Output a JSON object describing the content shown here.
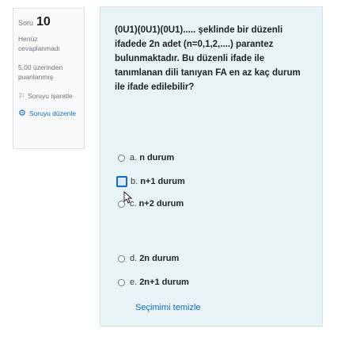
{
  "info": {
    "question_label": "Soru",
    "question_number": "10",
    "state": "Henüz cevaplanmadı",
    "grade": "5,00 üzerinden puanlanmış",
    "flag_label": "Soruyu işaretle",
    "edit_label": "Soruyu düzenle"
  },
  "question": {
    "text": "(0U1)(0U1)(0U1)..... şeklinde bir düzenli ifadede 2n adet (n=0,1,2,....) parantez bulunmaktadır. Bu düzenli ifade ile tanımlanan dili tanıyan FA en az kaç durum ile ifade edilebilir?"
  },
  "options": [
    {
      "letter": "a.",
      "text": "n durum"
    },
    {
      "letter": "b.",
      "text": "n+1 durum"
    },
    {
      "letter": "c.",
      "text": "n+2 durum"
    },
    {
      "letter": "d.",
      "text": "2n durum"
    },
    {
      "letter": "e.",
      "text": "2n+1 durum"
    }
  ],
  "clear_label": "Seçimimi temizle",
  "colors": {
    "accent": "#0f6cbf",
    "content_bg": "#e7f3f5",
    "info_bg": "#f8f9fa"
  }
}
